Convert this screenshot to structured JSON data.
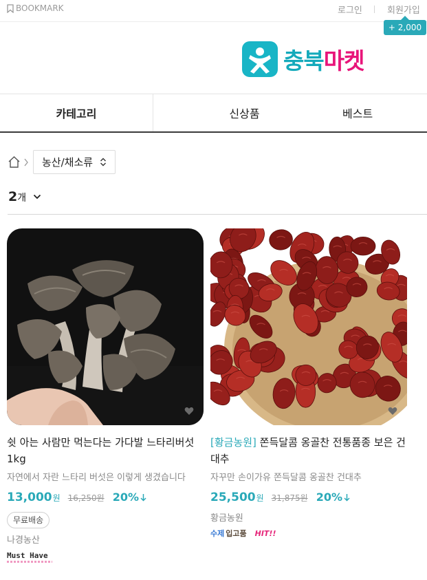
{
  "topbar": {
    "bookmark_label": "BOOKMARK",
    "login_label": "로그인",
    "signup_label": "회원가입",
    "points_badge": "+ 2,000"
  },
  "logo": {
    "text_part1": "충북",
    "text_part2": "마켓"
  },
  "category_nav": {
    "tabs": [
      {
        "label": "카테고리"
      },
      {
        "label": "신상품"
      },
      {
        "label": "베스트"
      }
    ]
  },
  "breadcrumb": {
    "selected_category": "농산/채소류"
  },
  "listing": {
    "count_number": "2",
    "count_unit": "개"
  },
  "products": [
    {
      "title": "쉿 아는 사람만 먹는다는 가다발 느타리버섯1kg",
      "subtitle": "자연에서 자란 느타리 버섯은 이렇게 생겼습니다",
      "price": "13,000",
      "currency": "원",
      "original_price": "16,250원",
      "discount": "20%",
      "tag": "무료배송",
      "seller": "나경농산",
      "badge": "Must Have"
    },
    {
      "brand": "[황금농원]",
      "title": " 쫀득달콤 옹골찬 전통품종 보은 건대추",
      "subtitle": "자꾸만 손이가유 쫀득달콤 옹골찬 건대추",
      "price": "25,500",
      "currency": "원",
      "original_price": "31,875원",
      "discount": "20%",
      "seller": "황금농원",
      "badge_handmade": "수제",
      "badge_hand_text": "입고품",
      "badge_hit": "HIT!!"
    }
  ],
  "colors": {
    "accent": "#2aa9b8",
    "logo_teal": "#19b5c6",
    "logo_pink": "#e8157a"
  }
}
